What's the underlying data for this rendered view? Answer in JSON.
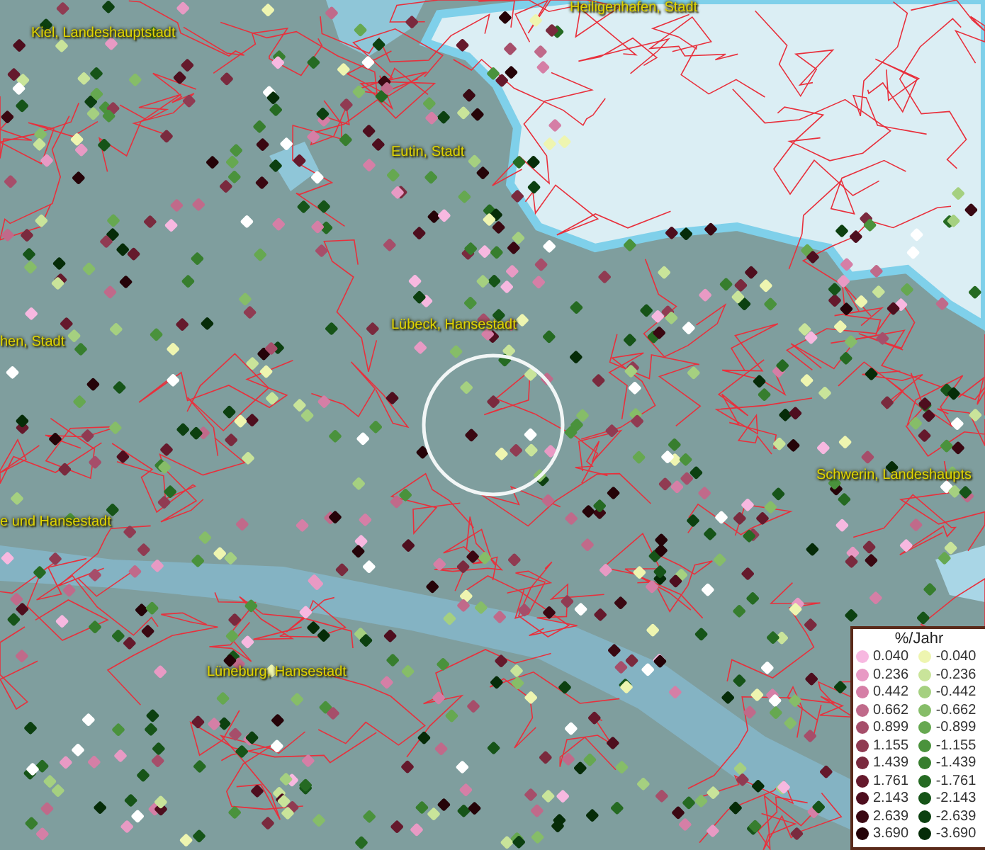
{
  "map": {
    "labels": [
      {
        "text": "Heiligenhafen, Stadt"
      },
      {
        "text": "Kiel, Landeshauptstadt"
      },
      {
        "text": "Eutin, Stadt"
      },
      {
        "text": "Lübeck, Hansestadt"
      },
      {
        "text": "hen, Stadt"
      },
      {
        "text": "Schwerin, Landeshaupts"
      },
      {
        "text": "e und Hansestadt"
      },
      {
        "text": "Lüneburg, Hansestadt"
      }
    ],
    "legend": {
      "title": "%/Jahr",
      "positive": [
        {
          "value": "0.040",
          "color": "#f7b8e0"
        },
        {
          "value": "0.236",
          "color": "#e89ac4"
        },
        {
          "value": "0.442",
          "color": "#d57fa6"
        },
        {
          "value": "0.662",
          "color": "#c06a8a"
        },
        {
          "value": "0.899",
          "color": "#a64e6a"
        },
        {
          "value": "1.155",
          "color": "#903b52"
        },
        {
          "value": "1.439",
          "color": "#7a2a3e"
        },
        {
          "value": "1.761",
          "color": "#65192c"
        },
        {
          "value": "2.143",
          "color": "#4e0e1e"
        },
        {
          "value": "2.639",
          "color": "#3a0812"
        },
        {
          "value": "3.690",
          "color": "#250308"
        }
      ],
      "negative": [
        {
          "value": "-0.040",
          "color": "#eef5b0"
        },
        {
          "value": "-0.236",
          "color": "#c9e49a"
        },
        {
          "value": "-0.442",
          "color": "#a5d080"
        },
        {
          "value": "-0.662",
          "color": "#86bd68"
        },
        {
          "value": "-0.899",
          "color": "#66a850"
        },
        {
          "value": "-1.155",
          "color": "#4a923c"
        },
        {
          "value": "-1.439",
          "color": "#377e2e"
        },
        {
          "value": "-1.761",
          "color": "#256a22"
        },
        {
          "value": "-2.143",
          "color": "#165418"
        },
        {
          "value": "-2.639",
          "color": "#0c4010"
        },
        {
          "value": "-3.690",
          "color": "#062c08"
        }
      ]
    }
  }
}
